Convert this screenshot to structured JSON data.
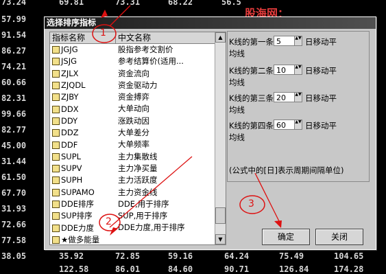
{
  "bg": {
    "top_row": [
      "73.24",
      "69.81",
      "73.31",
      "68.22",
      "56.5"
    ],
    "left_col": [
      "57.99",
      "91.54",
      "86.27",
      "74.21",
      "60.66",
      "82.31",
      "99.66",
      "82.77",
      "45.00",
      "31.44",
      "61.50",
      "67.70",
      "31.93",
      "72.66",
      "77.58"
    ],
    "bottom_row": [
      "38.05",
      "35.92",
      "72.85",
      "59.16",
      "64.24",
      "75.49",
      "104.65"
    ],
    "partial_bottom": [
      "122.58",
      "86.01",
      "84.60",
      "90.71",
      "126.84",
      "174.28"
    ]
  },
  "watermark": "股海网：www.guhai.com.cn",
  "dialog": {
    "title": "选择排序指标",
    "headers": [
      "指标名称",
      "中文名称"
    ],
    "rows": [
      {
        "code": "JGJG",
        "name": "股指参考交割价"
      },
      {
        "code": "JSJG",
        "name": "参考结算价(适用..."
      },
      {
        "code": "ZJLX",
        "name": "资金流向"
      },
      {
        "code": "ZJQDL",
        "name": "资金驱动力"
      },
      {
        "code": "ZJBY",
        "name": "资金搏弈"
      },
      {
        "code": "DDX",
        "name": "大单动向"
      },
      {
        "code": "DDY",
        "name": "涨跌动因"
      },
      {
        "code": "DDZ",
        "name": "大单差分"
      },
      {
        "code": "DDF",
        "name": "大单频率"
      },
      {
        "code": "SUPL",
        "name": "主力集散线"
      },
      {
        "code": "SUPV",
        "name": "主力净买量"
      },
      {
        "code": "SUPH",
        "name": "主力活跃度"
      },
      {
        "code": "SUPAMO",
        "name": "主力资金线"
      },
      {
        "code": "DDE排序",
        "name": "DDE,用于排序"
      },
      {
        "code": "SUP排序",
        "name": "SUP,用于排序"
      },
      {
        "code": "DDE力度",
        "name": "DDE力度,用于排序"
      },
      {
        "code": "★做多能量",
        "name": ""
      }
    ],
    "params": [
      {
        "label": "K线的第一条",
        "value": "5",
        "suffix": "日移动平",
        "wrap": "均线"
      },
      {
        "label": "K线的第二条",
        "value": "10",
        "suffix": "日移动平",
        "wrap": "均线"
      },
      {
        "label": "K线的第三条",
        "value": "20",
        "suffix": "日移动平",
        "wrap": "均线"
      },
      {
        "label": "K线的第四条",
        "value": "60",
        "suffix": "日移动平",
        "wrap": "均线"
      }
    ],
    "note": "(公式中的[日]表示周期间隔单位)",
    "ok": "确定",
    "close": "关闭"
  },
  "annotations": {
    "a1": "1",
    "a2": "2",
    "a3": "3"
  },
  "colors": {
    "annotation": "#dd1111",
    "background": "#000000"
  }
}
